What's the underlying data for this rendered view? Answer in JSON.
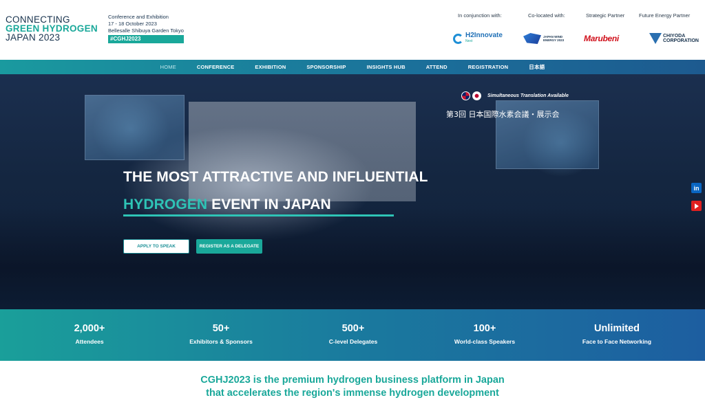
{
  "header": {
    "logo": {
      "line1": "CONNECTING",
      "line2": "GREEN HYDROGEN",
      "line3": "JAPAN 2023"
    },
    "event": {
      "type": "Conference and Exhibition",
      "dates": "17 - 18 October 2023",
      "venue": "Bellesalle Shibuya Garden Tokyo",
      "hashtag": "#CGHJ2023"
    },
    "partners": [
      {
        "label": "In conjunction with:",
        "name": "H2Innovate",
        "sub": "Next"
      },
      {
        "label": "Co-located with:",
        "name": "JAPAN WIND ENERGY 2023"
      },
      {
        "label": "Strategic Partner",
        "name": "Marubeni"
      },
      {
        "label": "Future Energy Partner",
        "name": "CHIYODA CORPORATION"
      }
    ]
  },
  "nav": {
    "items": [
      "HOME",
      "CONFERENCE",
      "EXHIBITION",
      "SPONSORSHIP",
      "INSIGHTS HUB",
      "ATTEND",
      "REGISTRATION",
      "日本語"
    ]
  },
  "hero": {
    "translation": "Simultaneous Translation Available",
    "jp_title": "第3回 日本国際水素会議・展示会",
    "headline_line1": "THE MOST ATTRACTIVE AND INFLUENTIAL",
    "headline_highlight": "HYDROGEN",
    "headline_line2_rest": " EVENT IN JAPAN",
    "btn_speak": "APPLY TO SPEAK",
    "btn_delegate": "REGISTER AS A DELEGATE",
    "social": {
      "linkedin": "in",
      "youtube": "youtube-icon"
    }
  },
  "stats": [
    {
      "num": "2,000+",
      "label": "Attendees"
    },
    {
      "num": "50+",
      "label": "Exhibitors & Sponsors"
    },
    {
      "num": "500+",
      "label": "C-level Delegates"
    },
    {
      "num": "100+",
      "label": "World-class Speakers"
    },
    {
      "num": "Unlimited",
      "label": "Face to Face Networking"
    }
  ],
  "intro": {
    "line1": "CGHJ2023 is the premium hydrogen business platform in Japan",
    "line2": "that accelerates the region's immense hydrogen development"
  },
  "colors": {
    "teal": "#1aa89a",
    "navy": "#17324d",
    "accent": "#2ec4b6"
  }
}
